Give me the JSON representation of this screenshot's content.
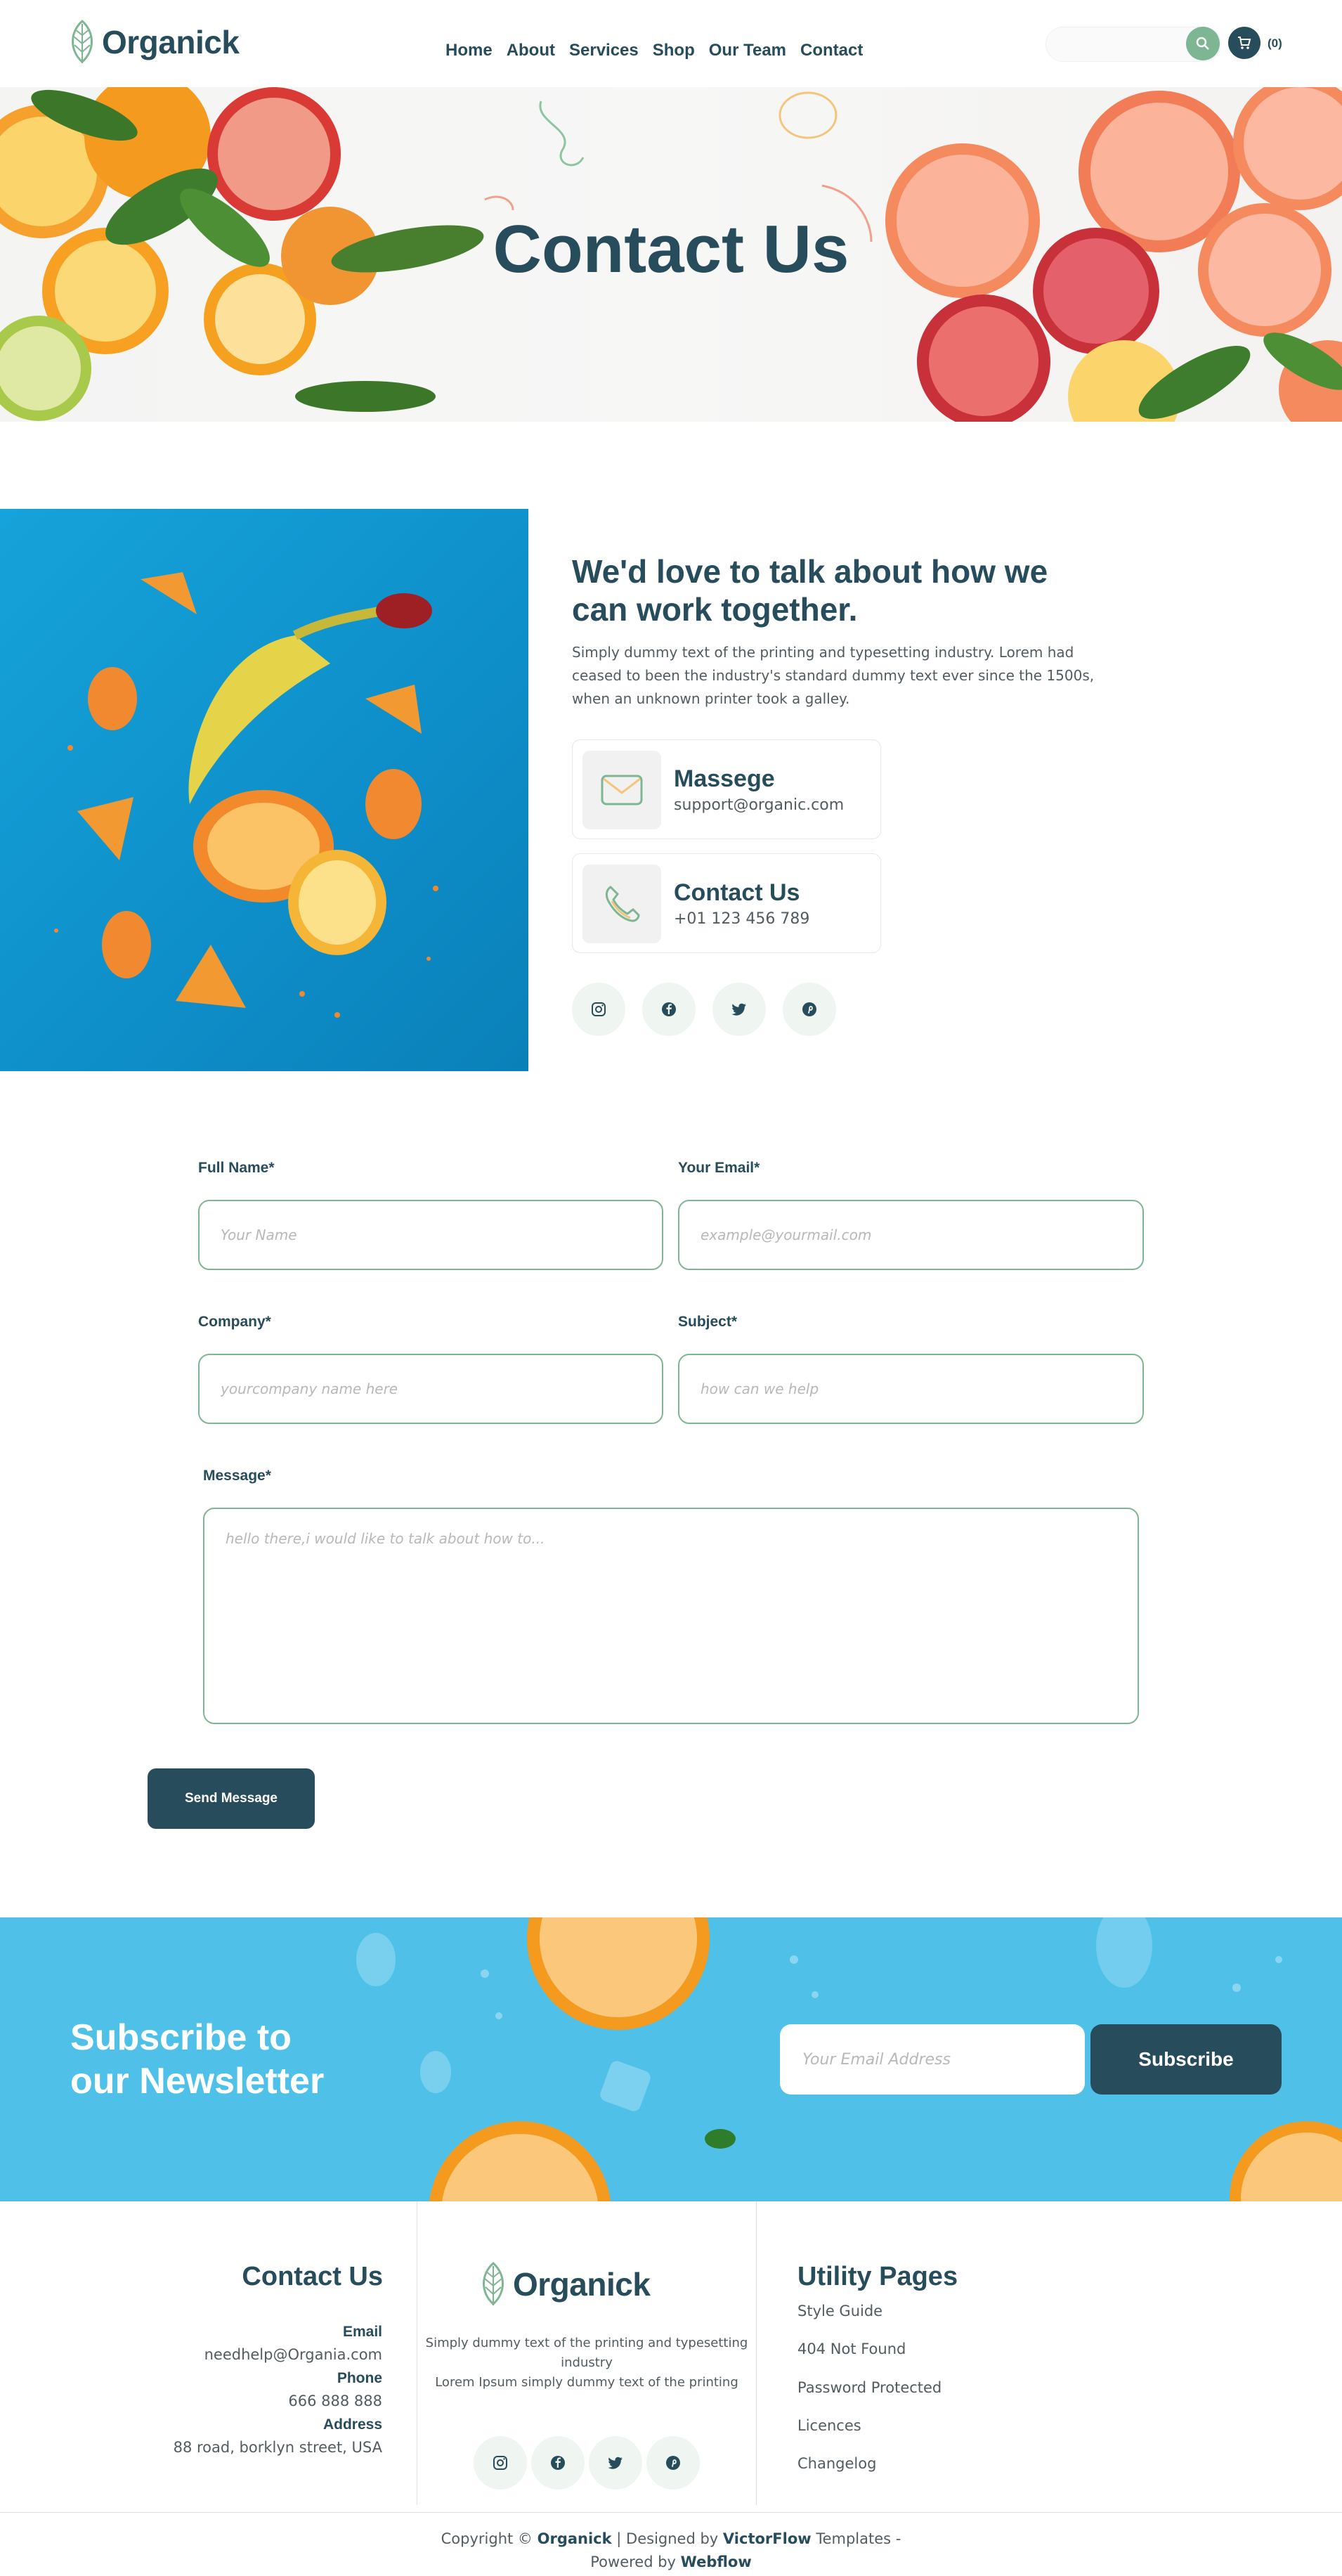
{
  "brand": {
    "name": "Organick",
    "primary": "#274c5b",
    "accent": "#7eb693",
    "newsletter_bg": "#4fc1e8"
  },
  "nav": {
    "items": [
      "Home",
      "About",
      "Services",
      "Shop",
      "Our Team",
      "Contact"
    ]
  },
  "header": {
    "search_icon": "search-icon",
    "cart_icon": "cart-icon",
    "cart_count": "(0)"
  },
  "hero": {
    "title": "Contact Us"
  },
  "intro": {
    "title": "We'd love to talk about how we can work together.",
    "text": "Simply dummy text of the printing and typesetting industry. Lorem had ceased to been the industry's standard dummy text ever since the 1500s, when an unknown printer took a galley."
  },
  "cards": [
    {
      "title": "Massege",
      "value": "support@organic.com",
      "icon": "envelope-icon"
    },
    {
      "title": "Contact Us",
      "value": "+01 123 456 789",
      "icon": "phone-icon"
    }
  ],
  "social": [
    "instagram-icon",
    "facebook-icon",
    "twitter-icon",
    "pinterest-icon"
  ],
  "form": {
    "full_name": {
      "label": "Full Name*",
      "placeholder": "Your Name"
    },
    "email": {
      "label": "Your Email*",
      "placeholder": "example@yourmail.com"
    },
    "company": {
      "label": "Company*",
      "placeholder": "yourcompany name here"
    },
    "subject": {
      "label": "Subject*",
      "placeholder": "how can we help"
    },
    "message": {
      "label": "Message*",
      "placeholder": "hello there,i would like to talk about how to..."
    },
    "submit": "Send Message"
  },
  "newsletter": {
    "title_line1": "Subscribe to",
    "title_line2": "our Newsletter",
    "placeholder": "Your Email Address",
    "button": "Subscribe"
  },
  "footer": {
    "contact": {
      "heading": "Contact Us",
      "email_label": "Email",
      "email": "needhelp@Organia.com",
      "phone_label": "Phone",
      "phone": "666 888 888",
      "address_label": "Address",
      "address": "88 road, borklyn street, USA"
    },
    "center": {
      "desc_line1": "Simply dummy text of the printing and typesetting",
      "desc_line2": "industry",
      "desc_line3": "Lorem Ipsum simply dummy text of the printing"
    },
    "utility": {
      "heading": "Utility Pages",
      "links": [
        "Style Guide",
        "404 Not Found",
        "Password Protected",
        "Licences",
        "Changelog"
      ]
    },
    "copyright": {
      "prefix": "Copyright ©",
      "brand": "Organick",
      "designed": "| Designed by",
      "designer": "VictorFlow",
      "templates": "Templates -",
      "powered": "Powered by",
      "platform": "Webflow"
    }
  }
}
